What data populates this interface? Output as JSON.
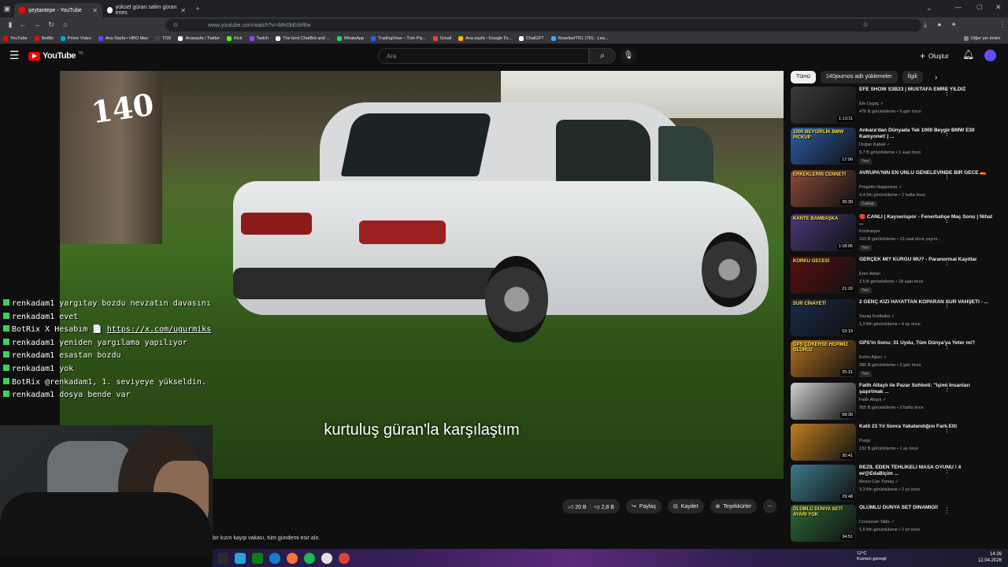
{
  "browser": {
    "tabs": [
      {
        "title": "şeytantepe - YouTube",
        "favicon_color": "#ff0000",
        "active": true
      },
      {
        "title": "yüksel güran salim güran enes",
        "favicon_color": "#ffffff",
        "active": false
      }
    ],
    "new_tab_symbol": "+",
    "url": "www.youtube.com/watch?v=iMn0bEshf6w",
    "bookmarks": [
      {
        "label": "YouTube",
        "color": "#ff0000"
      },
      {
        "label": "Netflix",
        "color": "#e50914"
      },
      {
        "label": "Prime Video",
        "color": "#00a8e1"
      },
      {
        "label": "Ana Sayfa • HBO Max",
        "color": "#7a3cff"
      },
      {
        "label": "TOD",
        "color": "#111111"
      },
      {
        "label": "Anasayfa / Twitter",
        "color": "#ffffff"
      },
      {
        "label": "Kick",
        "color": "#53fc18"
      },
      {
        "label": "Twitch",
        "color": "#9146ff"
      },
      {
        "label": "The best ChatBot and ...",
        "color": "#ffffff"
      },
      {
        "label": "WhatsApp",
        "color": "#25d366"
      },
      {
        "label": "TradingView – Tüm Piy...",
        "color": "#2962ff"
      },
      {
        "label": "Gmail",
        "color": "#ea4335"
      },
      {
        "label": "Ana sayfa - Google Dr...",
        "color": "#fbbc04"
      },
      {
        "label": "ChatGPT",
        "color": "#ffffff"
      },
      {
        "label": "Rosetta#TR1 (TR) - Lea...",
        "color": "#4aa3ff"
      }
    ],
    "other_bookmarks": "Diğer yer imleri"
  },
  "youtube": {
    "logo": "YouTube",
    "logo_sup": "TR",
    "search_placeholder": "Ara",
    "create_label": "Oluştur"
  },
  "video": {
    "watermark": "140",
    "subtitle": "kurtuluş güran'la karşılaştım",
    "likes": "20 B",
    "dislikes": "2,8 B",
    "share": "Paylaş",
    "save": "Kaydet",
    "thanks": "Teşekkürler",
    "description": "bir kızın kayıp vakası, tüm gündemi esir alır."
  },
  "chat": [
    {
      "user": "renkadam1",
      "text": "yargıtay bozdu nevzatın davasını"
    },
    {
      "user": "renkadam1",
      "text": "evet"
    },
    {
      "user": "BotRix",
      "text": "X Hesabım 📄 https://x.com/ugurmiks"
    },
    {
      "user": "renkadam1",
      "text": "yeniden yargılama yapılıyor"
    },
    {
      "user": "renkadam1",
      "text": "esastan bozdu"
    },
    {
      "user": "renkadam1",
      "text": "yok"
    },
    {
      "user": "BotRix",
      "text": "@renkadam1, 1. seviyeye yükseldin."
    },
    {
      "user": "renkadam1",
      "text": "dosya bende var"
    }
  ],
  "chips": [
    "Tümü",
    "140journos adlı yüklemeler",
    "İlgili"
  ],
  "recommendations": [
    {
      "title": "EFE SHOW S3B23 | MUSTAFA EMRE YILDIZ",
      "channel": "Efe Uygaç ✓",
      "meta": "476 B görüntüleme • 9 gün önce",
      "duration": "1:13:11",
      "badge": "",
      "thumb": "#3a3a3a",
      "thumbtext": ""
    },
    {
      "title": "Ankara'dan Dünyada Tek 1000 Beygir BMW E30 Kamyonet! | ...",
      "channel": "Doğan Kabak ✓",
      "meta": "9,7 B görüntüleme • 1 saat önce",
      "duration": "17:06",
      "badge": "Yeni",
      "thumb": "#2b5ea8",
      "thumbtext": "1000 BEYGİRLİK BMW PICKUP"
    },
    {
      "title": "AVRUPA'NIN EN ÜNLÜ GENELEVİNDE BİR GECE 🇩🇪",
      "channel": "Progetto Happiness ✓",
      "meta": "4,4 Mn görüntüleme • 2 hafta önce",
      "duration": "39:30",
      "badge": "Dublajlı",
      "thumb": "#8a4a3a",
      "thumbtext": "ERKEKLERİN CENNETİ"
    },
    {
      "title": "🔴 CANLI | Kayserispor - Fenerbahçe Maç Sonu | Nihat ...",
      "channel": "Kontraspor",
      "meta": "163 B görüntüleme • 13 saat önce yayınl...",
      "duration": "1:18:05",
      "badge": "Yeni",
      "thumb": "#4a3a7a",
      "thumbtext": "KANTE BAMBAŞKA"
    },
    {
      "title": "GERÇEK Mİ? KURGU MU? - Paranormal Kayıtlar",
      "channel": "Eren Aktan",
      "meta": "2,5 B görüntüleme • 18 saat önce",
      "duration": "21:20",
      "badge": "Yeni",
      "thumb": "#5a1010",
      "thumbtext": "KORKU GECESİ"
    },
    {
      "title": "2 GENÇ KIZI HAYATTAN KOPARAN SUR VAHŞETİ - ...",
      "channel": "Savaş Kurtbaba ✓",
      "meta": "1,9 Mn görüntüleme • 4 ay önce",
      "duration": "53:19",
      "badge": "",
      "thumb": "#1a2a4a",
      "thumbtext": "SUR CİNAYETİ"
    },
    {
      "title": "GPS'in Sonu: 31 Uydu, Tüm Dünya'ya Yeter mi?",
      "channel": "Evrim Ağacı ✓",
      "meta": "385 B görüntüleme • 2 gün önce",
      "duration": "25:31",
      "badge": "Yeni",
      "thumb": "#b07020",
      "thumbtext": "GPS ÇÖKERSE HEPİMİZ ÖLÜRÜZ"
    },
    {
      "title": "Fatih Altaylı ile Pazar Sohbeti: \"İşimi İnsanları şaşırtmak ...",
      "channel": "Fatih Altaylı ✓",
      "meta": "955 B görüntüleme • 2 hafta önce",
      "duration": "58:30",
      "badge": "",
      "thumb": "#cfcfcf",
      "thumbtext": ""
    },
    {
      "title": "Katil 23 Yıl Sonra Yakalandığını Fark Etti",
      "channel": "Purgy",
      "meta": "132 B görüntüleme • 1 ay önce",
      "duration": "30:41",
      "badge": "",
      "thumb": "#c08020",
      "thumbtext": ""
    },
    {
      "title": "REZİL EDEN TEHLİKELİ MASA OYUNU ! 4 w/@EdaBiçim ...",
      "channel": "Mesut Can Tomay ✓",
      "meta": "3,3 Mn görüntüleme • 2 yıl önce",
      "duration": "29:48",
      "badge": "",
      "thumb": "#3a7a8a",
      "thumbtext": ""
    },
    {
      "title": "ÖLÜMLÜ DÜNYA SET DİNAMİĞİ!",
      "channel": "Crossover Talks ✓",
      "meta": "1,6 Mn görüntüleme • 2 yıl önce",
      "duration": "34:51",
      "badge": "",
      "thumb": "#2a6a3a",
      "thumbtext": "ÖLÜMLÜ DÜNYA SETİ AYARI YOK"
    }
  ],
  "taskbar": {
    "weather_temp": "12°C",
    "weather_desc": "Kısmen güneşli",
    "time": "14:26",
    "date": "12.04.2026"
  }
}
